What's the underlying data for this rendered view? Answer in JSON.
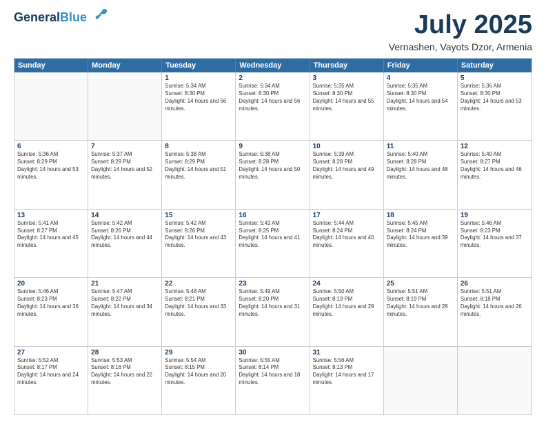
{
  "header": {
    "logo_line1": "General",
    "logo_line2": "Blue",
    "month_title": "July 2025",
    "location": "Vernashen, Vayots Dzor, Armenia"
  },
  "weekdays": [
    "Sunday",
    "Monday",
    "Tuesday",
    "Wednesday",
    "Thursday",
    "Friday",
    "Saturday"
  ],
  "rows": [
    [
      {
        "day": "",
        "sunrise": "",
        "sunset": "",
        "daylight": ""
      },
      {
        "day": "",
        "sunrise": "",
        "sunset": "",
        "daylight": ""
      },
      {
        "day": "1",
        "sunrise": "Sunrise: 5:34 AM",
        "sunset": "Sunset: 8:30 PM",
        "daylight": "Daylight: 14 hours and 56 minutes."
      },
      {
        "day": "2",
        "sunrise": "Sunrise: 5:34 AM",
        "sunset": "Sunset: 8:30 PM",
        "daylight": "Daylight: 14 hours and 56 minutes."
      },
      {
        "day": "3",
        "sunrise": "Sunrise: 5:35 AM",
        "sunset": "Sunset: 8:30 PM",
        "daylight": "Daylight: 14 hours and 55 minutes."
      },
      {
        "day": "4",
        "sunrise": "Sunrise: 5:35 AM",
        "sunset": "Sunset: 8:30 PM",
        "daylight": "Daylight: 14 hours and 54 minutes."
      },
      {
        "day": "5",
        "sunrise": "Sunrise: 5:36 AM",
        "sunset": "Sunset: 8:30 PM",
        "daylight": "Daylight: 14 hours and 53 minutes."
      }
    ],
    [
      {
        "day": "6",
        "sunrise": "Sunrise: 5:36 AM",
        "sunset": "Sunset: 8:29 PM",
        "daylight": "Daylight: 14 hours and 53 minutes."
      },
      {
        "day": "7",
        "sunrise": "Sunrise: 5:37 AM",
        "sunset": "Sunset: 8:29 PM",
        "daylight": "Daylight: 14 hours and 52 minutes."
      },
      {
        "day": "8",
        "sunrise": "Sunrise: 5:38 AM",
        "sunset": "Sunset: 8:29 PM",
        "daylight": "Daylight: 14 hours and 51 minutes."
      },
      {
        "day": "9",
        "sunrise": "Sunrise: 5:38 AM",
        "sunset": "Sunset: 8:28 PM",
        "daylight": "Daylight: 14 hours and 50 minutes."
      },
      {
        "day": "10",
        "sunrise": "Sunrise: 5:39 AM",
        "sunset": "Sunset: 8:28 PM",
        "daylight": "Daylight: 14 hours and 49 minutes."
      },
      {
        "day": "11",
        "sunrise": "Sunrise: 5:40 AM",
        "sunset": "Sunset: 8:28 PM",
        "daylight": "Daylight: 14 hours and 48 minutes."
      },
      {
        "day": "12",
        "sunrise": "Sunrise: 5:40 AM",
        "sunset": "Sunset: 8:27 PM",
        "daylight": "Daylight: 14 hours and 46 minutes."
      }
    ],
    [
      {
        "day": "13",
        "sunrise": "Sunrise: 5:41 AM",
        "sunset": "Sunset: 8:27 PM",
        "daylight": "Daylight: 14 hours and 45 minutes."
      },
      {
        "day": "14",
        "sunrise": "Sunrise: 5:42 AM",
        "sunset": "Sunset: 8:26 PM",
        "daylight": "Daylight: 14 hours and 44 minutes."
      },
      {
        "day": "15",
        "sunrise": "Sunrise: 5:42 AM",
        "sunset": "Sunset: 8:26 PM",
        "daylight": "Daylight: 14 hours and 43 minutes."
      },
      {
        "day": "16",
        "sunrise": "Sunrise: 5:43 AM",
        "sunset": "Sunset: 8:25 PM",
        "daylight": "Daylight: 14 hours and 41 minutes."
      },
      {
        "day": "17",
        "sunrise": "Sunrise: 5:44 AM",
        "sunset": "Sunset: 8:24 PM",
        "daylight": "Daylight: 14 hours and 40 minutes."
      },
      {
        "day": "18",
        "sunrise": "Sunrise: 5:45 AM",
        "sunset": "Sunset: 8:24 PM",
        "daylight": "Daylight: 14 hours and 39 minutes."
      },
      {
        "day": "19",
        "sunrise": "Sunrise: 5:46 AM",
        "sunset": "Sunset: 8:23 PM",
        "daylight": "Daylight: 14 hours and 37 minutes."
      }
    ],
    [
      {
        "day": "20",
        "sunrise": "Sunrise: 5:46 AM",
        "sunset": "Sunset: 8:23 PM",
        "daylight": "Daylight: 14 hours and 36 minutes."
      },
      {
        "day": "21",
        "sunrise": "Sunrise: 5:47 AM",
        "sunset": "Sunset: 8:22 PM",
        "daylight": "Daylight: 14 hours and 34 minutes."
      },
      {
        "day": "22",
        "sunrise": "Sunrise: 5:48 AM",
        "sunset": "Sunset: 8:21 PM",
        "daylight": "Daylight: 14 hours and 33 minutes."
      },
      {
        "day": "23",
        "sunrise": "Sunrise: 5:49 AM",
        "sunset": "Sunset: 8:20 PM",
        "daylight": "Daylight: 14 hours and 31 minutes."
      },
      {
        "day": "24",
        "sunrise": "Sunrise: 5:50 AM",
        "sunset": "Sunset: 8:19 PM",
        "daylight": "Daylight: 14 hours and 29 minutes."
      },
      {
        "day": "25",
        "sunrise": "Sunrise: 5:51 AM",
        "sunset": "Sunset: 8:19 PM",
        "daylight": "Daylight: 14 hours and 28 minutes."
      },
      {
        "day": "26",
        "sunrise": "Sunrise: 5:51 AM",
        "sunset": "Sunset: 8:18 PM",
        "daylight": "Daylight: 14 hours and 26 minutes."
      }
    ],
    [
      {
        "day": "27",
        "sunrise": "Sunrise: 5:52 AM",
        "sunset": "Sunset: 8:17 PM",
        "daylight": "Daylight: 14 hours and 24 minutes."
      },
      {
        "day": "28",
        "sunrise": "Sunrise: 5:53 AM",
        "sunset": "Sunset: 8:16 PM",
        "daylight": "Daylight: 14 hours and 22 minutes."
      },
      {
        "day": "29",
        "sunrise": "Sunrise: 5:54 AM",
        "sunset": "Sunset: 8:15 PM",
        "daylight": "Daylight: 14 hours and 20 minutes."
      },
      {
        "day": "30",
        "sunrise": "Sunrise: 5:55 AM",
        "sunset": "Sunset: 8:14 PM",
        "daylight": "Daylight: 14 hours and 18 minutes."
      },
      {
        "day": "31",
        "sunrise": "Sunrise: 5:56 AM",
        "sunset": "Sunset: 8:13 PM",
        "daylight": "Daylight: 14 hours and 17 minutes."
      },
      {
        "day": "",
        "sunrise": "",
        "sunset": "",
        "daylight": ""
      },
      {
        "day": "",
        "sunrise": "",
        "sunset": "",
        "daylight": ""
      }
    ]
  ]
}
